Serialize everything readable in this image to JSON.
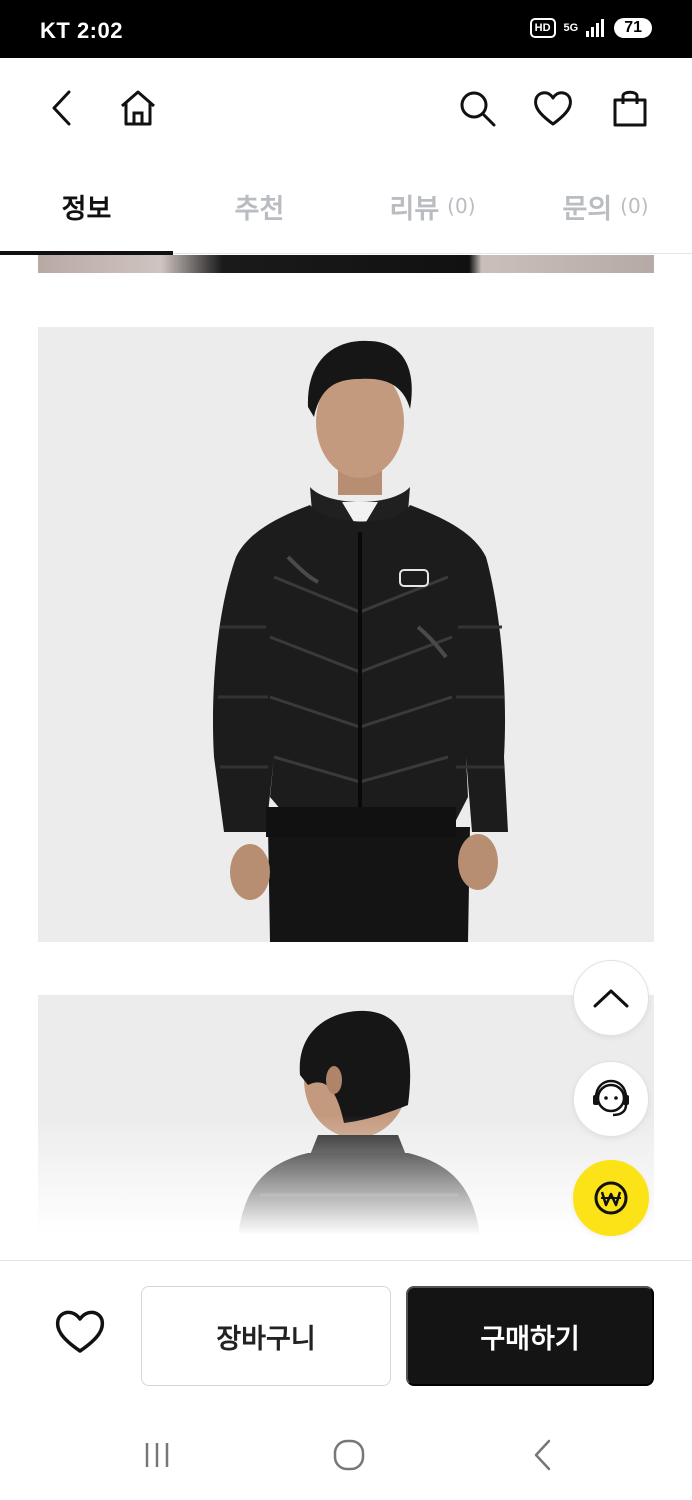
{
  "status_bar": {
    "carrier_time": "KT 2:02",
    "hd": "HD",
    "network": "5G",
    "battery": "71"
  },
  "header": {
    "icons": [
      "back-icon",
      "home-icon",
      "search-icon",
      "heart-icon",
      "shopping-bag-icon"
    ]
  },
  "tabs": [
    {
      "label": "정보",
      "count": "",
      "active": true
    },
    {
      "label": "추천",
      "count": "",
      "active": false
    },
    {
      "label": "리뷰",
      "count": "(0)",
      "active": false
    },
    {
      "label": "문의",
      "count": "(0)",
      "active": false
    }
  ],
  "content": {
    "images": [
      "product-photo-front",
      "product-photo-back"
    ],
    "colors": {
      "image_bg": "#ececec",
      "jacket": "#1c1c1c"
    }
  },
  "floating": {
    "icons": [
      "chevron-up-icon",
      "customer-service-icon",
      "won-pay-icon"
    ],
    "pay_color": "#fbe317"
  },
  "bottom_bar": {
    "cart_label": "장바구니",
    "buy_label": "구매하기",
    "buy_bg": "#141414"
  },
  "nav_bar": {
    "icons": [
      "recent-apps-icon",
      "home-circle-icon",
      "back-nav-icon"
    ]
  }
}
